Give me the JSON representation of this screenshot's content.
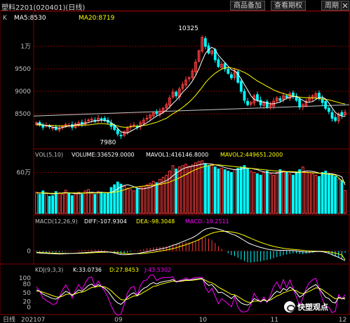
{
  "window": {
    "title": "塑料2201(020401)(日线)",
    "buttons": [
      "商品备加",
      "查看期权",
      "周期"
    ],
    "close_icon": "close-icon"
  },
  "price_panel": {
    "label_k": "K",
    "ma5_label": "MA5:8530",
    "ma20_label": "MA20:8719",
    "high_label": "10325",
    "low_label": "7980",
    "y_ticks": [
      "1万",
      "9500",
      "9000",
      "8500"
    ],
    "y_tick_values": [
      10000,
      9500,
      9000,
      8500
    ],
    "price_range": [
      7750,
      10500
    ]
  },
  "volume_panel": {
    "label": "VOL(5,10)",
    "volume_label": "VOLUME:336529.0000",
    "mavol1_label": "MAVOL1:416146.8000",
    "mavol2_label": "MAVOL2:449651.2000",
    "y_tick": "60万",
    "y_tick_value": 600000,
    "vol_max": 780000
  },
  "macd_panel": {
    "label": "MACD(12,26,9)",
    "diff_label": "DIFF:-107.9304",
    "dea_label": "DEA:-98.3048",
    "macd_label": "MACD:-19.2511",
    "y_tick": "0"
  },
  "kdj_panel": {
    "label": "KDJ(9,3,3)",
    "k_label": "K:33.0736",
    "d_label": "D:27.8453",
    "j_label": "J:43.5302",
    "y_ticks": [
      "100",
      "80",
      "50",
      "20",
      "0"
    ],
    "y_tick_values": [
      100,
      80,
      50,
      20,
      0
    ]
  },
  "time_axis": {
    "label": "日线",
    "ticks": [
      "202107",
      "09",
      "10",
      "11",
      "12"
    ]
  },
  "watermark": {
    "text": "快塑观点"
  },
  "colors": {
    "up": "#ff4040",
    "down": "#00ffff",
    "ma5": "#ffffff",
    "ma20": "#ffff00",
    "mavol2": "#ff00ff",
    "k_line": "#ffffff",
    "d_line": "#ffff00",
    "j_line": "#ff00ff",
    "grid": "#800000"
  },
  "chart_data": {
    "type": "candlestick",
    "closes": [
      8300,
      8260,
      8200,
      8240,
      8210,
      8190,
      8150,
      8180,
      8220,
      8260,
      8240,
      8200,
      8280,
      8300,
      8270,
      8320,
      8360,
      8380,
      8330,
      8400,
      8370,
      8350,
      8310,
      8220,
      8150,
      8050,
      8010,
      8100,
      8180,
      8230,
      8250,
      8200,
      8300,
      8360,
      8400,
      8470,
      8520,
      8500,
      8560,
      8620,
      8700,
      8850,
      8980,
      8900,
      9050,
      9150,
      9250,
      9300,
      9450,
      9650,
      9900,
      10200,
      10000,
      9850,
      9900,
      9700,
      9550,
      9600,
      9500,
      9400,
      9300,
      9450,
      9200,
      9000,
      8800,
      8700,
      8750,
      8900,
      8800,
      8700,
      8750,
      8650,
      8700,
      8780,
      8850,
      8800,
      8900,
      8860,
      8950,
      8900,
      8800,
      8650,
      8700,
      8780,
      8850,
      8900,
      8950,
      8850,
      8750,
      8620,
      8550,
      8400,
      8350,
      8500,
      8470,
      8530
    ],
    "ma5": [
      8280,
      8270,
      8250,
      8240,
      8230,
      8200,
      8190,
      8180,
      8190,
      8210,
      8230,
      8240,
      8250,
      8260,
      8270,
      8290,
      8300,
      8330,
      8340,
      8350,
      8360,
      8350,
      8340,
      8300,
      8250,
      8170,
      8100,
      8080,
      8070,
      8110,
      8150,
      8190,
      8220,
      8260,
      8300,
      8350,
      8400,
      8450,
      8480,
      8530,
      8580,
      8650,
      8730,
      8800,
      8880,
      8980,
      9050,
      9130,
      9230,
      9350,
      9500,
      9680,
      9840,
      9930,
      9980,
      9930,
      9800,
      9720,
      9640,
      9560,
      9480,
      9460,
      9380,
      9280,
      9150,
      9030,
      8900,
      8820,
      8790,
      8770,
      8760,
      8740,
      8720,
      8720,
      8740,
      8760,
      8800,
      8840,
      8870,
      8880,
      8890,
      8840,
      8800,
      8760,
      8760,
      8770,
      8820,
      8860,
      8870,
      8830,
      8740,
      8630,
      8530,
      8480,
      8450,
      8440
    ],
    "ma20": [
      8250,
      8250,
      8250,
      8240,
      8240,
      8240,
      8230,
      8230,
      8230,
      8230,
      8230,
      8230,
      8240,
      8240,
      8240,
      8250,
      8250,
      8260,
      8270,
      8280,
      8280,
      8280,
      8270,
      8260,
      8250,
      8230,
      8210,
      8200,
      8200,
      8210,
      8220,
      8220,
      8230,
      8240,
      8250,
      8270,
      8290,
      8310,
      8340,
      8370,
      8400,
      8450,
      8500,
      8540,
      8590,
      8640,
      8700,
      8760,
      8830,
      8910,
      9000,
      9090,
      9190,
      9270,
      9340,
      9400,
      9450,
      9490,
      9520,
      9530,
      9520,
      9500,
      9480,
      9450,
      9420,
      9380,
      9330,
      9280,
      9230,
      9190,
      9150,
      9110,
      9070,
      9030,
      9000,
      8970,
      8950,
      8930,
      8910,
      8890,
      8880,
      8870,
      8860,
      8860,
      8860,
      8850,
      8850,
      8840,
      8830,
      8820,
      8810,
      8790,
      8770,
      8750,
      8730,
      8719
    ],
    "volume": [
      310,
      280,
      330,
      300,
      250,
      260,
      320,
      300,
      280,
      340,
      300,
      260,
      290,
      310,
      280,
      330,
      350,
      300,
      280,
      320,
      310,
      290,
      300,
      380,
      420,
      460,
      430,
      400,
      370,
      350,
      330,
      360,
      380,
      400,
      420,
      440,
      470,
      450,
      500,
      530,
      560,
      620,
      700,
      650,
      680,
      700,
      720,
      690,
      710,
      740,
      760,
      770,
      730,
      700,
      720,
      680,
      650,
      660,
      640,
      620,
      600,
      640,
      660,
      680,
      700,
      650,
      620,
      600,
      580,
      560,
      600,
      620,
      580,
      560,
      600,
      640,
      620,
      600,
      580,
      560,
      600,
      640,
      680,
      620,
      600,
      580,
      560,
      540,
      600,
      620,
      580,
      560,
      540,
      500,
      480,
      336
    ],
    "mavol1": [
      300,
      300,
      295,
      295,
      290,
      285,
      290,
      295,
      300,
      305,
      300,
      295,
      290,
      290,
      295,
      300,
      305,
      310,
      305,
      305,
      310,
      305,
      300,
      310,
      330,
      360,
      390,
      410,
      420,
      410,
      390,
      370,
      360,
      360,
      370,
      380,
      400,
      420,
      440,
      460,
      480,
      510,
      550,
      590,
      620,
      650,
      670,
      680,
      690,
      700,
      710,
      720,
      730,
      725,
      720,
      710,
      700,
      690,
      670,
      660,
      650,
      640,
      640,
      650,
      660,
      660,
      660,
      650,
      640,
      620,
      610,
      600,
      595,
      590,
      590,
      600,
      610,
      610,
      605,
      600,
      595,
      600,
      610,
      620,
      620,
      615,
      605,
      590,
      580,
      580,
      585,
      580,
      570,
      555,
      535,
      416
    ],
    "mavol2": [
      300,
      300,
      300,
      300,
      295,
      295,
      295,
      295,
      295,
      300,
      300,
      300,
      300,
      300,
      300,
      300,
      300,
      300,
      300,
      300,
      305,
      305,
      305,
      305,
      310,
      320,
      330,
      345,
      360,
      375,
      385,
      390,
      395,
      400,
      405,
      410,
      415,
      420,
      425,
      435,
      445,
      460,
      480,
      500,
      520,
      545,
      570,
      595,
      620,
      640,
      660,
      675,
      690,
      700,
      705,
      710,
      710,
      705,
      700,
      695,
      690,
      685,
      680,
      675,
      670,
      665,
      660,
      655,
      650,
      645,
      640,
      635,
      630,
      625,
      620,
      618,
      616,
      614,
      612,
      610,
      608,
      605,
      602,
      600,
      598,
      595,
      592,
      588,
      585,
      580,
      575,
      568,
      560,
      520,
      480,
      449
    ],
    "diff": [
      -20,
      -22,
      -25,
      -26,
      -28,
      -30,
      -32,
      -33,
      -32,
      -30,
      -28,
      -27,
      -25,
      -22,
      -20,
      -18,
      -15,
      -12,
      -10,
      -8,
      -7,
      -8,
      -10,
      -15,
      -22,
      -32,
      -40,
      -42,
      -40,
      -36,
      -32,
      -28,
      -22,
      -15,
      -8,
      0,
      8,
      15,
      22,
      30,
      38,
      50,
      65,
      75,
      90,
      105,
      120,
      135,
      150,
      170,
      195,
      225,
      245,
      255,
      260,
      255,
      245,
      235,
      222,
      208,
      192,
      180,
      162,
      140,
      118,
      95,
      78,
      65,
      52,
      40,
      32,
      22,
      16,
      12,
      10,
      8,
      8,
      6,
      6,
      5,
      2,
      -5,
      -10,
      -12,
      -12,
      -10,
      -6,
      -5,
      -8,
      -15,
      -25,
      -40,
      -55,
      -70,
      -90,
      -108
    ],
    "dea": [
      -15,
      -16,
      -18,
      -19,
      -21,
      -23,
      -24,
      -26,
      -27,
      -27,
      -27,
      -27,
      -26,
      -26,
      -25,
      -24,
      -22,
      -20,
      -18,
      -16,
      -14,
      -13,
      -12,
      -13,
      -15,
      -18,
      -23,
      -27,
      -30,
      -31,
      -31,
      -30,
      -29,
      -26,
      -23,
      -18,
      -13,
      -7,
      -1,
      5,
      12,
      19,
      28,
      37,
      48,
      59,
      71,
      84,
      97,
      112,
      128,
      148,
      168,
      185,
      200,
      210,
      218,
      222,
      222,
      220,
      215,
      208,
      200,
      188,
      174,
      158,
      143,
      127,
      112,
      98,
      85,
      73,
      62,
      52,
      44,
      37,
      31,
      26,
      22,
      19,
      16,
      12,
      8,
      4,
      1,
      -1,
      -2,
      -3,
      -4,
      -6,
      -10,
      -16,
      -24,
      -33,
      -45,
      -98
    ],
    "k": [
      60,
      55,
      45,
      40,
      35,
      30,
      28,
      35,
      45,
      55,
      50,
      40,
      50,
      60,
      55,
      65,
      75,
      80,
      70,
      78,
      72,
      65,
      55,
      40,
      25,
      15,
      10,
      20,
      35,
      45,
      50,
      40,
      55,
      65,
      70,
      80,
      85,
      80,
      85,
      88,
      90,
      92,
      95,
      88,
      90,
      92,
      95,
      93,
      95,
      97,
      98,
      99,
      85,
      75,
      78,
      65,
      50,
      52,
      45,
      38,
      30,
      40,
      25,
      15,
      10,
      8,
      15,
      30,
      25,
      20,
      28,
      20,
      30,
      45,
      55,
      50,
      65,
      58,
      70,
      62,
      50,
      35,
      42,
      55,
      65,
      72,
      78,
      65,
      50,
      35,
      30,
      18,
      15,
      35,
      30,
      33
    ],
    "d": [
      55,
      55,
      52,
      48,
      44,
      40,
      36,
      35,
      38,
      44,
      46,
      44,
      46,
      51,
      52,
      56,
      62,
      68,
      69,
      72,
      72,
      70,
      65,
      57,
      46,
      36,
      27,
      25,
      28,
      34,
      39,
      40,
      45,
      52,
      58,
      65,
      72,
      74,
      78,
      81,
      84,
      87,
      90,
      89,
      89,
      90,
      92,
      92,
      93,
      94,
      96,
      97,
      93,
      87,
      84,
      78,
      69,
      63,
      57,
      51,
      44,
      43,
      37,
      30,
      23,
      18,
      17,
      21,
      22,
      21,
      24,
      22,
      25,
      32,
      39,
      43,
      50,
      53,
      58,
      60,
      57,
      50,
      47,
      50,
      55,
      61,
      67,
      66,
      61,
      52,
      45,
      36,
      29,
      31,
      31,
      28
    ],
    "j": [
      70,
      55,
      31,
      24,
      17,
      10,
      12,
      35,
      59,
      77,
      58,
      32,
      58,
      78,
      61,
      83,
      101,
      104,
      72,
      90,
      72,
      55,
      35,
      6,
      -17,
      -27,
      -24,
      10,
      49,
      67,
      72,
      40,
      75,
      91,
      94,
      110,
      111,
      92,
      99,
      102,
      102,
      102,
      105,
      86,
      92,
      96,
      101,
      95,
      99,
      103,
      102,
      103,
      69,
      51,
      66,
      39,
      12,
      30,
      21,
      12,
      2,
      34,
      1,
      -15,
      -16,
      -12,
      11,
      48,
      31,
      18,
      36,
      16,
      40,
      71,
      87,
      64,
      95,
      68,
      94,
      66,
      36,
      5,
      32,
      65,
      85,
      94,
      100,
      63,
      28,
      1,
      0,
      -18,
      -13,
      43,
      28,
      43
    ]
  }
}
